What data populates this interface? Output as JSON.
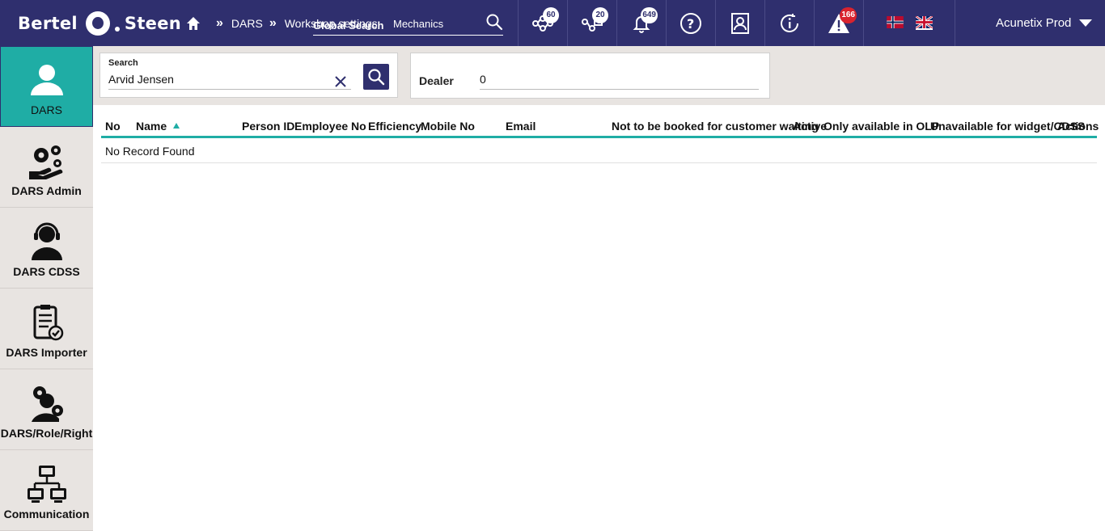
{
  "brand": {
    "word1": "Bertel",
    "word2": "Steen"
  },
  "breadcrumb": {
    "items": [
      "DARS",
      "Workshop settings",
      "Mechanics"
    ],
    "separator": "»"
  },
  "global_search": {
    "placeholder": "Global Search"
  },
  "top_icons": [
    {
      "name": "workflow-icon",
      "badge": "60"
    },
    {
      "name": "workflow-question-icon",
      "badge": "20"
    },
    {
      "name": "bell-icon",
      "badge": "649"
    },
    {
      "name": "help-icon",
      "badge": ""
    },
    {
      "name": "contact-card-icon",
      "badge": ""
    },
    {
      "name": "info-refresh-icon",
      "badge": ""
    },
    {
      "name": "alert-icon",
      "badge": "166"
    }
  ],
  "user": {
    "name": "Acunetix Prod"
  },
  "sidebar": {
    "items": [
      {
        "label": "DARS",
        "active": true
      },
      {
        "label": "DARS Admin",
        "active": false
      },
      {
        "label": "DARS CDSS",
        "active": false
      },
      {
        "label": "DARS Importer",
        "active": false
      },
      {
        "label": "DARS/Role/Right",
        "active": false
      },
      {
        "label": "Communication",
        "active": false
      }
    ]
  },
  "filters": {
    "search_label": "Search",
    "search_value": "Arvid Jensen",
    "dealer_label": "Dealer",
    "dealer_value": "0"
  },
  "table": {
    "columns": [
      "No",
      "Name",
      "Person ID",
      "Employee No",
      "Efficiency",
      "Mobile No",
      "Email",
      "Not to be booked for customer waiting",
      "Active",
      "Only available in OLP",
      "Unavailable for widget/CDSS",
      "Actions"
    ],
    "sorted_column": "Name",
    "empty_message": "No Record Found"
  },
  "colors": {
    "header_bg": "#2f2f6e",
    "accent": "#1fada5",
    "panel_bg": "#e8e4e1",
    "badge_red": "#d9232e"
  }
}
